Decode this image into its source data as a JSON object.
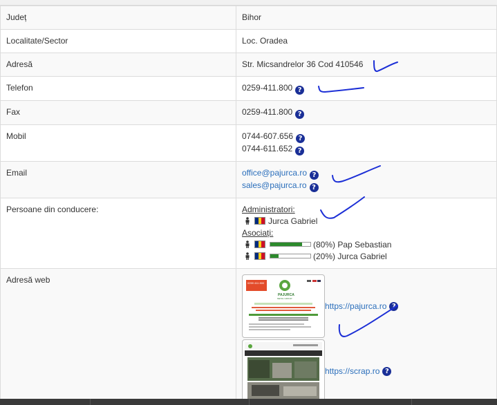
{
  "rows": {
    "judet": {
      "label": "Județ",
      "value": "Bihor"
    },
    "localitate": {
      "label": "Localitate/Sector",
      "value": "Loc. Oradea"
    },
    "adresa": {
      "label": "Adresă",
      "value": "Str. Micsandrelor 36 Cod 410546"
    },
    "telefon": {
      "label": "Telefon",
      "value": "0259-411.800"
    },
    "fax": {
      "label": "Fax",
      "value": "0259-411.800"
    },
    "mobil": {
      "label": "Mobil",
      "values": [
        "0744-607.656",
        "0744-611.652"
      ]
    },
    "email": {
      "label": "Email",
      "values": [
        "office@pajurca.ro",
        "sales@pajurca.ro"
      ]
    },
    "conducere": {
      "label": "Persoane din conducere:",
      "admin_heading": "Administratori:",
      "admins": [
        {
          "name": "Jurca Gabriel"
        }
      ],
      "assoc_heading": "Asociați:",
      "associates": [
        {
          "share": 0.8,
          "share_label": "(80%)",
          "name": "Pap Sebastian"
        },
        {
          "share": 0.2,
          "share_label": "(20%)",
          "name": "Jurca Gabriel"
        }
      ]
    },
    "web": {
      "label": "Adresă web",
      "sites": [
        {
          "url": "https://pajurca.ro",
          "thumb_brand": "PAJURCA",
          "thumb_subtitle": "METAL GROUP",
          "thumb_phone": "0259 411 800"
        },
        {
          "url": "https://scrap.ro"
        }
      ]
    }
  },
  "help_glyph": "?",
  "colors": {
    "link": "#2a6ebb",
    "help_badge": "#1a2f97",
    "bar_fill": "#2c8a2c",
    "ink": "#1c2fd6"
  },
  "icons": [
    "question-circle-icon",
    "person-icon",
    "romania-flag-icon"
  ]
}
